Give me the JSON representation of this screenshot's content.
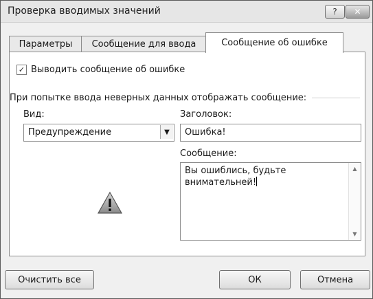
{
  "window": {
    "title": "Проверка вводимых значений",
    "help_glyph": "?",
    "close_glyph": "✕"
  },
  "tabs": [
    {
      "label": "Параметры"
    },
    {
      "label": "Сообщение для ввода"
    },
    {
      "label": "Сообщение об ошибке",
      "active": true
    }
  ],
  "panel": {
    "show_error": {
      "label": "Выводить сообщение об ошибке",
      "checked": true
    },
    "section_label": "При попытке ввода неверных данных отображать сообщение:",
    "style_label": "Вид:",
    "style_value": "Предупреждение",
    "title_label": "Заголовок:",
    "title_value": "Ошибка!",
    "message_label": "Сообщение:",
    "message_value": "Вы ошиблись, будьте внимательней!",
    "icon": "warning-triangle-icon"
  },
  "buttons": {
    "clear_all": "Очистить все",
    "ok": "ОК",
    "cancel": "Отмена"
  }
}
